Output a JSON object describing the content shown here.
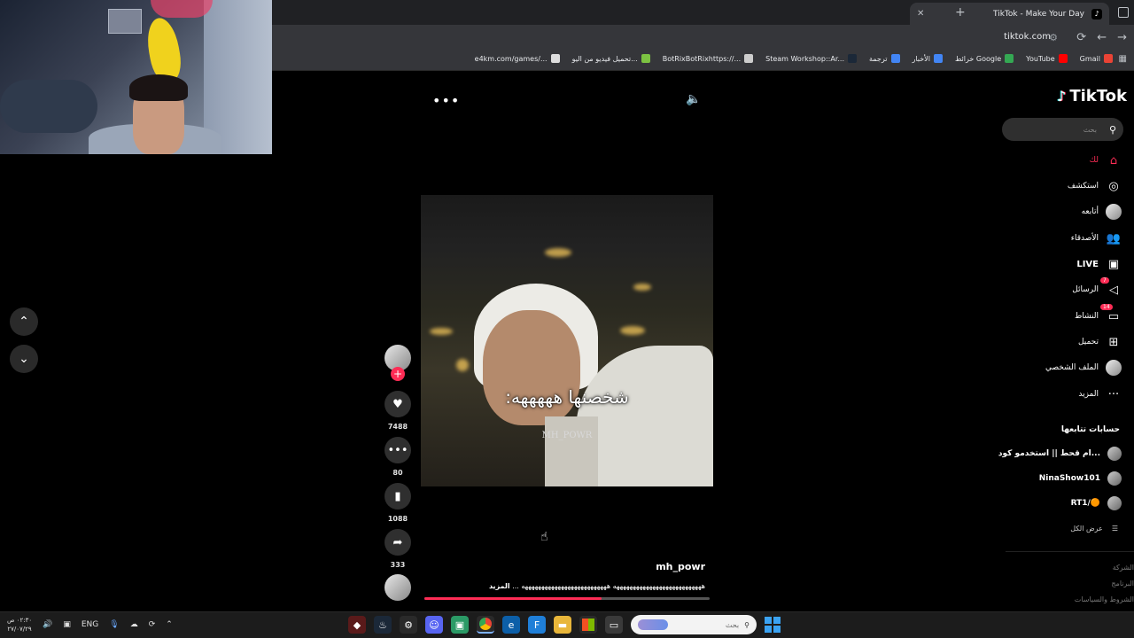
{
  "browser": {
    "tab_title": "TikTok - Make Your Day",
    "new_tab_symbol": "+",
    "tab_close_symbol": "✕",
    "url": "tiktok.com",
    "bookmarks": [
      {
        "label": "Gmail",
        "color": "#ea4335"
      },
      {
        "label": "YouTube",
        "color": "#ff0000"
      },
      {
        "label": "خرائط Google",
        "color": "#34a853"
      },
      {
        "label": "الأخبار",
        "color": "#4285f4"
      },
      {
        "label": "ترجمة",
        "color": "#4285f4"
      },
      {
        "label": "Steam Workshop::Ar...",
        "color": "#1b2838"
      },
      {
        "label": "BotRixBotRixhttps://...",
        "color": "#cccccc"
      },
      {
        "label": "تحميل فيديو من اليو...",
        "color": "#7cc242"
      },
      {
        "label": "e4km.com/games/...",
        "color": "#dddddd"
      }
    ]
  },
  "tiktok": {
    "logo_text": "TikTok",
    "search_placeholder": "بحث",
    "sidebar": [
      {
        "label": "لك",
        "icon": "home-icon",
        "glyph": "⌂",
        "active": true
      },
      {
        "label": "استكشف",
        "icon": "compass-icon",
        "glyph": "◎"
      },
      {
        "label": "أتابعه",
        "icon": "following-avatar-icon",
        "glyph": "●"
      },
      {
        "label": "الأصدقاء",
        "icon": "friends-icon",
        "glyph": "👥"
      },
      {
        "label": "LIVE",
        "icon": "live-icon",
        "glyph": "▣"
      },
      {
        "label": "الرسائل",
        "icon": "messages-icon",
        "glyph": "◁",
        "badge": "7"
      },
      {
        "label": "النشاط",
        "icon": "activity-icon",
        "glyph": "▭",
        "badge": "14"
      },
      {
        "label": "تحميل",
        "icon": "upload-icon",
        "glyph": "⊞"
      },
      {
        "label": "الملف الشخصي",
        "icon": "profile-icon",
        "glyph": "●"
      },
      {
        "label": "المزيد",
        "icon": "more-icon",
        "glyph": "···"
      }
    ],
    "following_title": "حسابات تتابعها",
    "following_accounts": [
      {
        "name": "ام قحط || استخدمو كود..."
      },
      {
        "name": "NinaShow101"
      },
      {
        "name": "RT1/🟠"
      }
    ],
    "see_all": "عرض الكل",
    "footer_links": [
      "الشركة",
      "البرنامج",
      "الشروط والسياسات"
    ],
    "video": {
      "caption": "شخصنها هههههه:",
      "watermark": "MH_POWR",
      "username": "mh_powr",
      "description": "هههههههههههههههههههههههههههه ههههههههههههههههههههههههههه ...",
      "more_label": "المزيد",
      "progress": 0.62
    },
    "actions": {
      "likes": "7488",
      "comments": "80",
      "saves": "1088",
      "shares": "333"
    }
  },
  "taskbar": {
    "lang": "ENG",
    "time": "٠٢:٣٠ ص",
    "date": "٢٧/٠٧/٢٩",
    "search_placeholder": "بحث"
  }
}
